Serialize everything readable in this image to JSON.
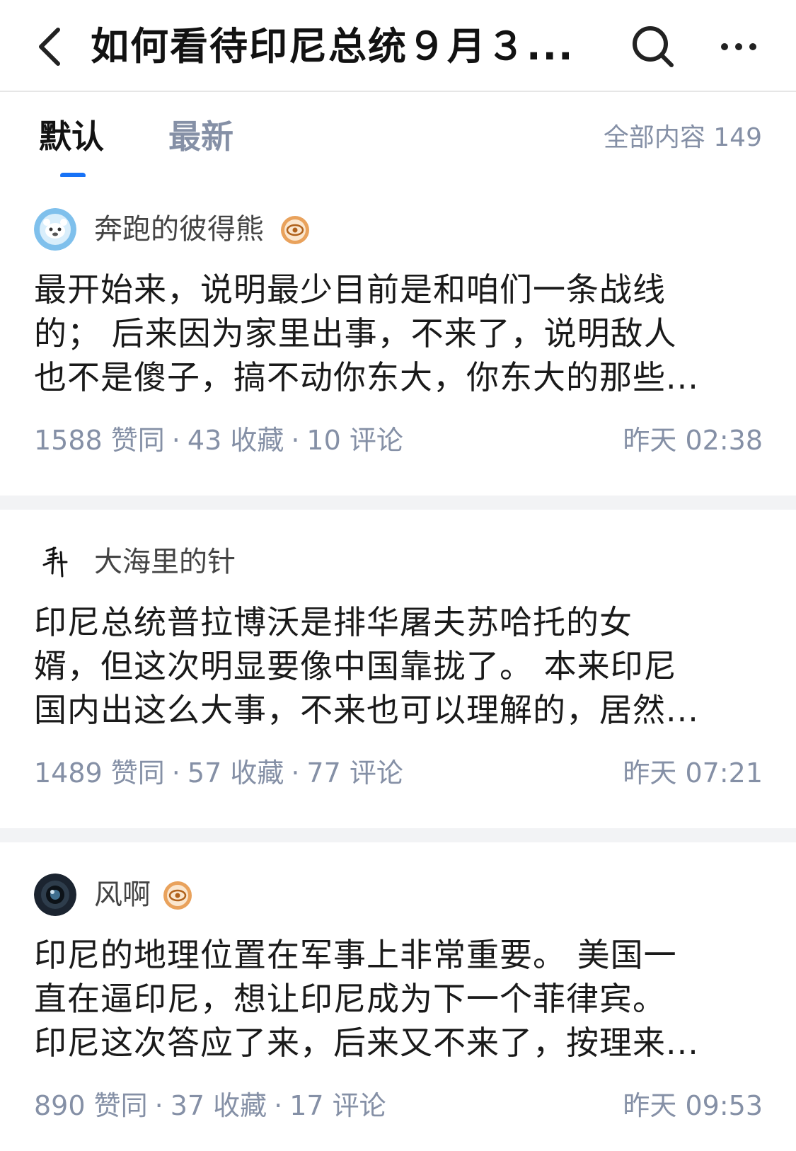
{
  "header": {
    "title": "如何看待印尼总统９月３...",
    "back_icon": "chevron-left-icon",
    "search_icon": "search-icon",
    "more_icon": "more-horizontal-icon"
  },
  "tabs": [
    {
      "label": "默认",
      "active": true
    },
    {
      "label": "最新",
      "active": false
    }
  ],
  "total_count": "全部内容 149",
  "colors": {
    "accent": "#1772f6",
    "secondary_text": "#8590a6",
    "separator": "#f2f3f5"
  },
  "answers": [
    {
      "author": "奔跑的彼得熊",
      "has_badge": true,
      "lines": [
        "最开始来，说明最少目前是和咱们一条战线",
        "的；  后来因为家里出事，不来了，说明敌人",
        "也不是傻子，搞不动你东大，你东大的那些..."
      ],
      "likes": "1588 赞同",
      "favorites": "43 收藏",
      "comments": "10 评论",
      "time": "昨天 02:38"
    },
    {
      "author": "大海里的针",
      "has_badge": false,
      "lines": [
        "印尼总统普拉博沃是排华屠夫苏哈托的女",
        "婿，但这次明显要像中国靠拢了。 本来印尼",
        "国内出这么大事，不来也可以理解的，居然..."
      ],
      "likes": "1489 赞同",
      "favorites": "57 收藏",
      "comments": "77 评论",
      "time": "昨天 07:21"
    },
    {
      "author": "风啊",
      "has_badge": true,
      "lines": [
        "印尼的地理位置在军事上非常重要。 美国一",
        "直在逼印尼，想让印尼成为下一个菲律宾。",
        "印尼这次答应了来，后来又不来了，按理来..."
      ],
      "likes": "890 赞同",
      "favorites": "37 收藏",
      "comments": "17 评论",
      "time": "昨天 09:53"
    }
  ]
}
